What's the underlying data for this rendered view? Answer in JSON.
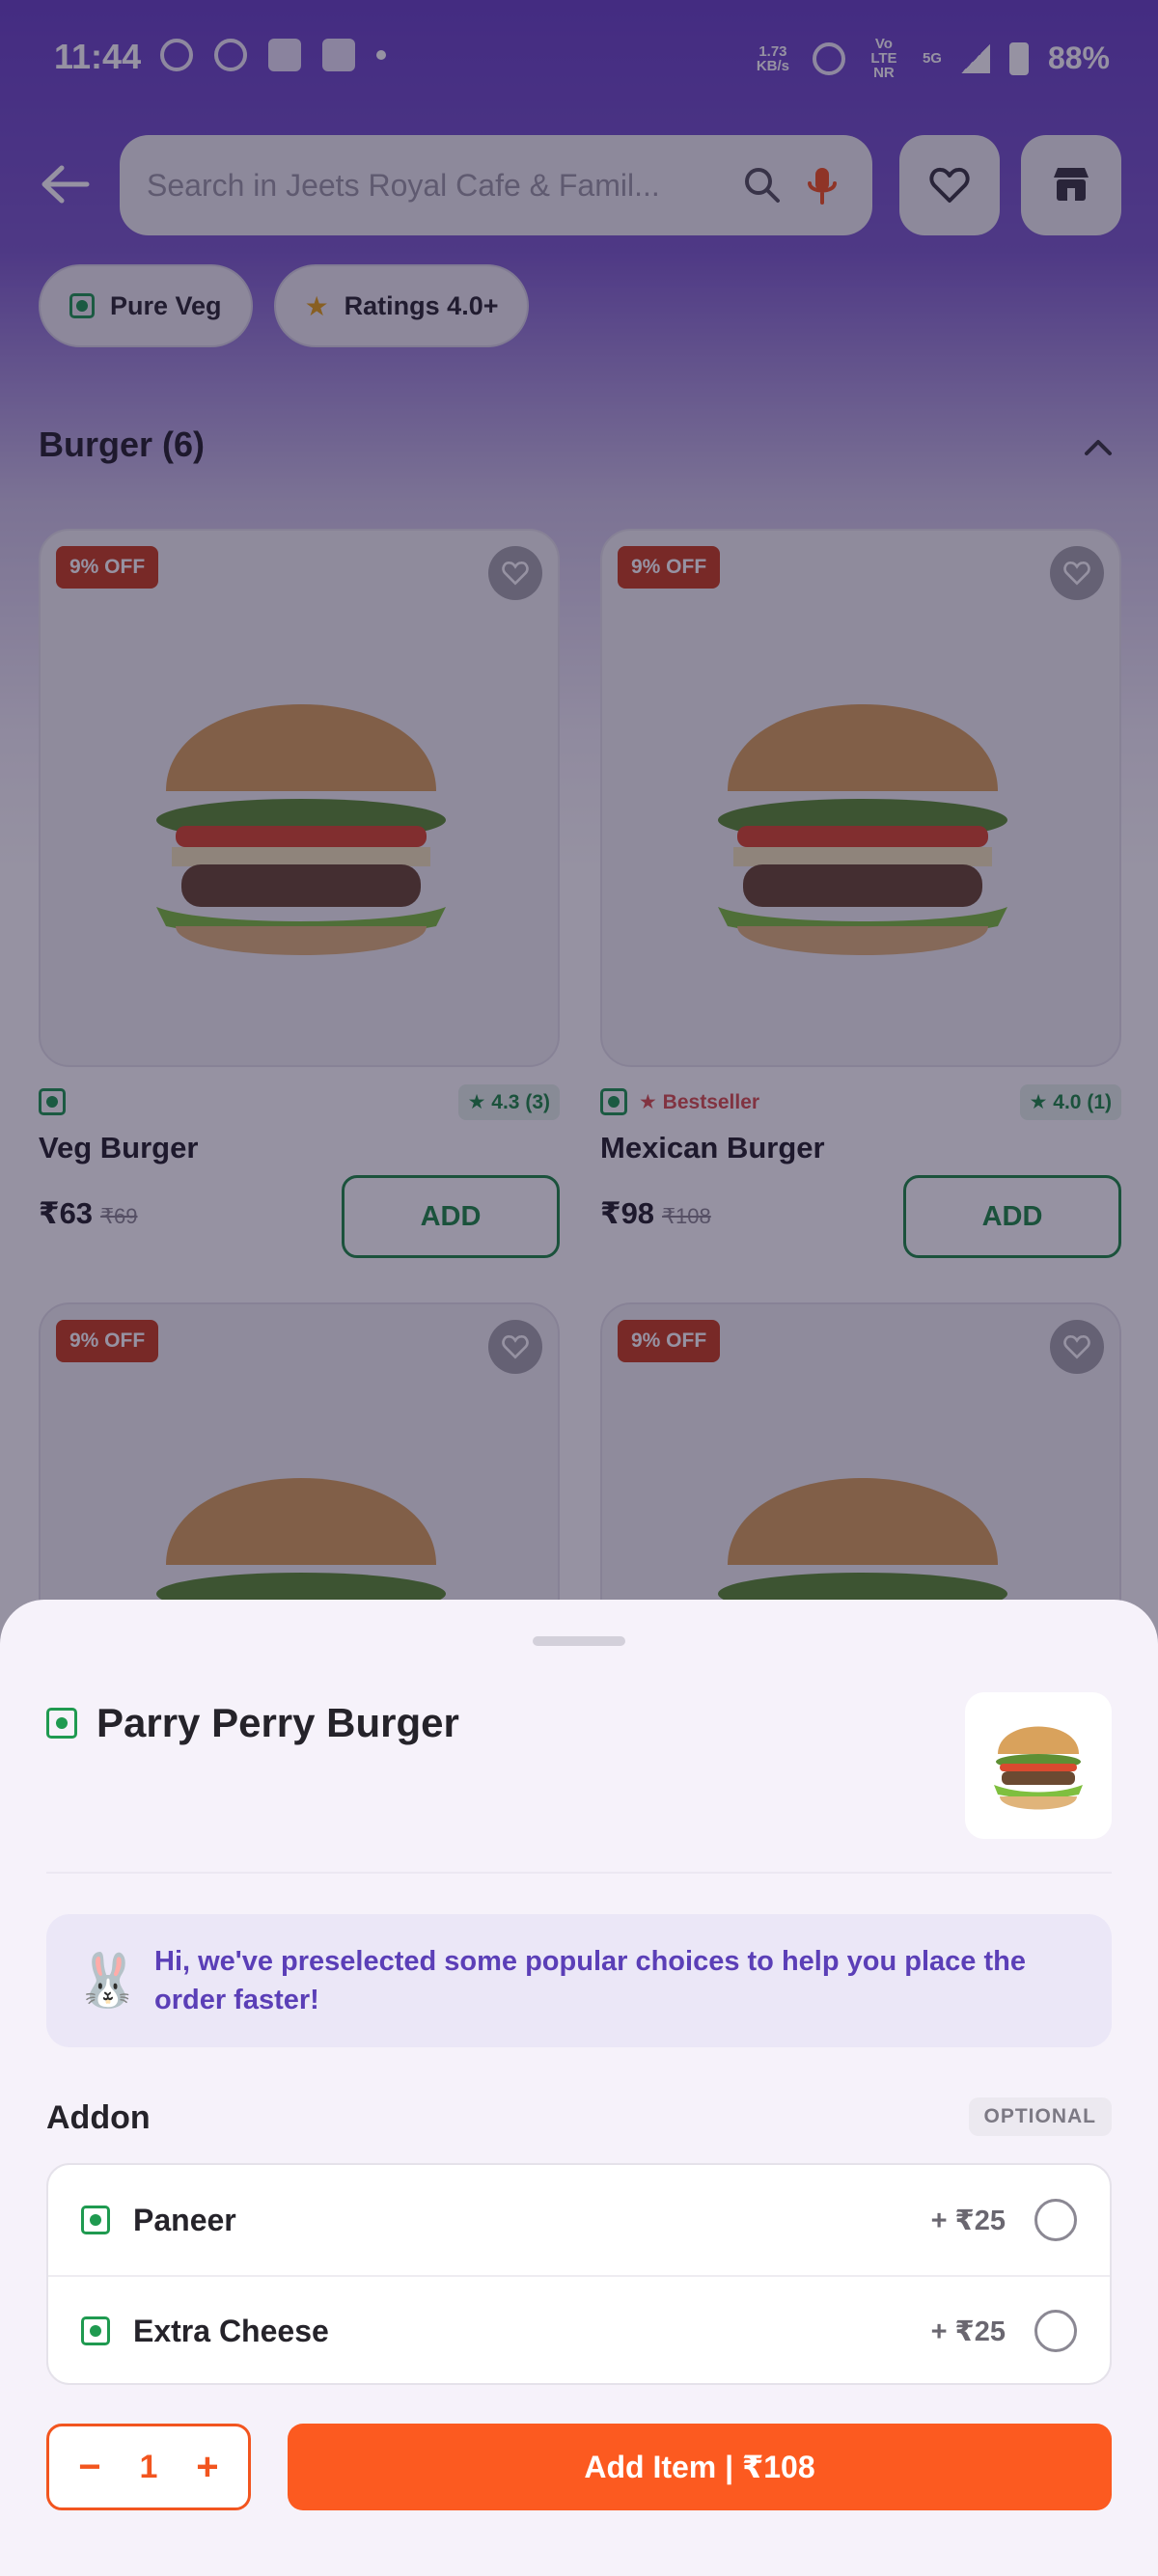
{
  "status_bar": {
    "time": "11:44",
    "network_speed": "1.73 KB/s",
    "carrier": "Vo LTE NR",
    "network": "5G",
    "battery": "88%"
  },
  "search": {
    "placeholder": "Search in Jeets Royal Cafe & Famil..."
  },
  "filters": [
    {
      "label": "Pure Veg",
      "icon": "veg-icon"
    },
    {
      "label": "Ratings 4.0+",
      "icon": "star-icon"
    }
  ],
  "section": {
    "title": "Burger (6)"
  },
  "items": [
    {
      "discount": "9% OFF",
      "name": "Veg Burger",
      "rating": "4.3 (3)",
      "bestseller": "",
      "price": "₹63",
      "mrp": "₹69",
      "add_label": "ADD"
    },
    {
      "discount": "9% OFF",
      "name": "Mexican Burger",
      "rating": "4.0 (1)",
      "bestseller": "Bestseller",
      "price": "₹98",
      "mrp": "₹108",
      "add_label": "ADD"
    },
    {
      "discount": "9% OFF"
    },
    {
      "discount": "9% OFF"
    }
  ],
  "sheet": {
    "title": "Parry Perry Burger",
    "info": "Hi, we've preselected some popular choices to help you place the order faster!",
    "addon_title": "Addon",
    "addon_tag": "OPTIONAL",
    "addons": [
      {
        "name": "Paneer",
        "price": "+ ₹25",
        "selected": false
      },
      {
        "name": "Extra Cheese",
        "price": "+ ₹25",
        "selected": false
      }
    ],
    "quantity": "1",
    "decrement_label": "−",
    "increment_label": "+",
    "cta_label": "Add Item | ₹108"
  },
  "colors": {
    "brand_orange": "#fc5a20",
    "veg_green": "#1f9a50",
    "header_purple": "#6a45c4",
    "info_text": "#5b3fb7"
  }
}
